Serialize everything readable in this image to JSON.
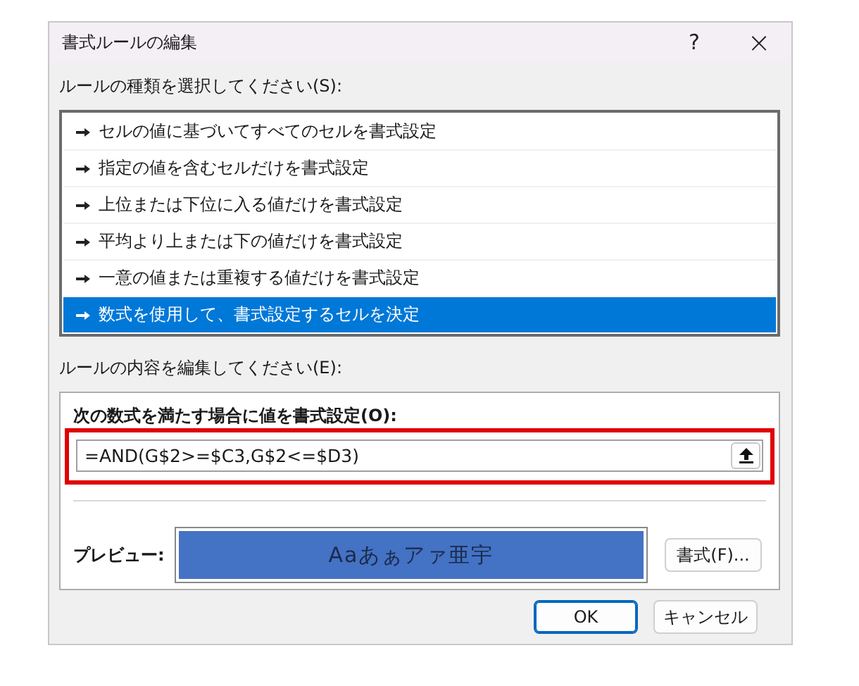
{
  "window": {
    "title": "書式ルールの編集",
    "help": "?",
    "close": "×"
  },
  "rule_type": {
    "label": "ルールの種類を選択してください(S):",
    "items": [
      {
        "label": "セルの値に基づいてすべてのセルを書式設定",
        "selected": false
      },
      {
        "label": "指定の値を含むセルだけを書式設定",
        "selected": false
      },
      {
        "label": "上位または下位に入る値だけを書式設定",
        "selected": false
      },
      {
        "label": "平均より上または下の値だけを書式設定",
        "selected": false
      },
      {
        "label": "一意の値または重複する値だけを書式設定",
        "selected": false
      },
      {
        "label": "数式を使用して、書式設定するセルを決定",
        "selected": true
      }
    ]
  },
  "rule_edit": {
    "label": "ルールの内容を編集してください(E):",
    "formula_label": "次の数式を満たす場合に値を書式設定(O):",
    "formula": {
      "value": "=AND(G$2>=$C3,G$2<=$D3)",
      "highlighted": true
    },
    "preview_label": "プレビュー:",
    "preview_text": "Aaあぁアァ亜宇",
    "format_button": "書式(F)..."
  },
  "buttons": [
    "OK",
    "キャンセル"
  ]
}
